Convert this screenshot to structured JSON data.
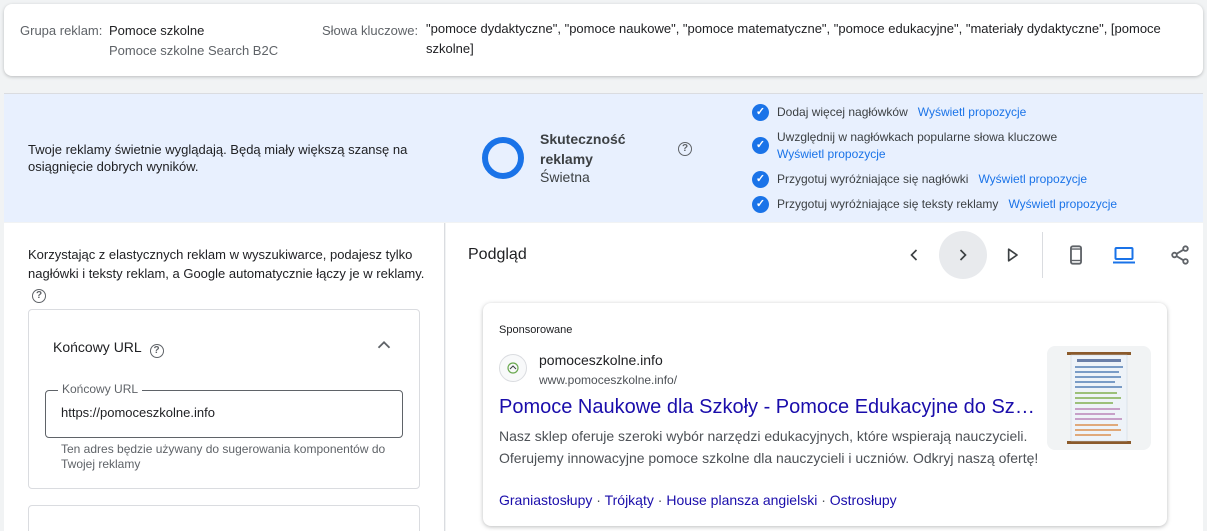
{
  "top": {
    "ad_group_label": "Grupa reklam:",
    "ad_group_name": "Pomoce szkolne",
    "campaign_name": "Pomoce szkolne Search B2C",
    "keywords_label": "Słowa kluczowe:",
    "keywords": "\"pomoce dydaktyczne\", \"pomoce naukowe\", \"pomoce matematyczne\", \"pomoce edukacyjne\", \"materiały dydaktyczne\", [pomoce szkolne]"
  },
  "strength": {
    "message": "Twoje reklamy świetnie wyglądają. Będą miały większą szansę na osiągnięcie dobrych wyników.",
    "title": "Skuteczność reklamy",
    "value": "Świetna",
    "ring_color": "#1a73e8",
    "suggestions": [
      {
        "text": "Dodaj więcej nagłówków",
        "link": "Wyświetl propozycje"
      },
      {
        "text": "Uwzględnij w nagłówkach popularne słowa kluczowe",
        "link": "Wyświetl propozycje"
      },
      {
        "text": "Przygotuj wyróżniające się nagłówki",
        "link": "Wyświetl propozycje"
      },
      {
        "text": "Przygotuj wyróżniające się teksty reklamy",
        "link": "Wyświetl propozycje"
      }
    ]
  },
  "editor": {
    "intro": "Korzystając z elastycznych reklam w wyszukiwarce, podajesz tylko nagłówki i teksty reklam, a Google automatycznie łączy je w reklamy.",
    "final_url_section": "Końcowy URL",
    "final_url_field_label": "Końcowy URL",
    "final_url_value": "https://pomoceszkolne.info",
    "final_url_help": "Ten adres będzie używany do sugerowania komponentów do Twojej reklamy"
  },
  "preview": {
    "title": "Podgląd",
    "sponsored": "Sponsorowane",
    "site_name": "pomoceszkolne.info",
    "display_url": "www.pomoceszkolne.info/",
    "headline": "Pomoce Naukowe dla Szkoły - Pomoce Edukacyjne do Szkoły",
    "description": "Nasz sklep oferuje szeroki wybór narzędzi edukacyjnych, które wspierają nauczycieli. Oferujemy innowacyjne pomoce szkolne dla nauczycieli i uczniów. Odkryj naszą ofertę!",
    "sitelinks": [
      "Graniastosłupy",
      "Trójkąty",
      "House plansza angielski",
      "Ostrosłupy"
    ],
    "separator": "·"
  }
}
